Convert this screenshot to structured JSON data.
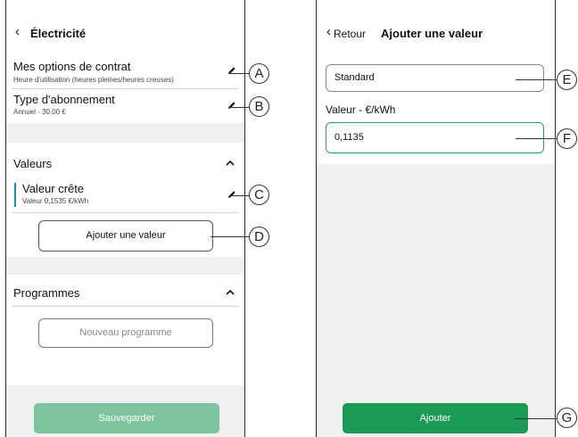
{
  "left_screen": {
    "back_icon": "chevron-left-icon",
    "title": "Électricité",
    "contract_options": {
      "title": "Mes options de contrat",
      "subtitle": "Heure d'utilisation (heures pleines/heures creuses)"
    },
    "subscription": {
      "title": "Type d'abonnement",
      "subtitle": "Annuel - 30,00 €"
    },
    "values_section": {
      "title": "Valeurs",
      "peak_value": {
        "title": "Valeur crête",
        "subtitle": "Valeur 0,1535 €/kWh"
      },
      "add_button": "Ajouter une valeur"
    },
    "programs_section": {
      "title": "Programmes",
      "new_button": "Nouveau programme"
    },
    "save_button": "Sauvegarder"
  },
  "right_screen": {
    "back_label": "Retour",
    "title": "Ajouter une valeur",
    "name_field": {
      "value": "Standard"
    },
    "value_label": "Valeur - €/kWh",
    "value_field": {
      "value": "0,1135"
    },
    "add_button": "Ajouter"
  },
  "callouts": [
    "A",
    "B",
    "C",
    "D",
    "E",
    "F",
    "G"
  ],
  "colors": {
    "accent_green": "#1a9a55",
    "save_green": "#7fc4a1",
    "peak_bar": "#1f8ea3",
    "input_focus_border": "#2c9f5a"
  }
}
